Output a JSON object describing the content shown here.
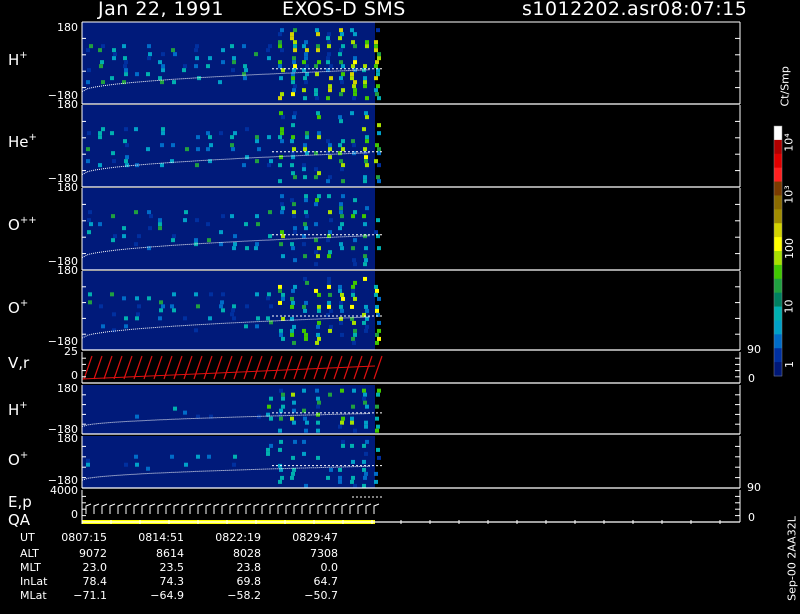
{
  "header": {
    "date": "Jan 22, 1991",
    "mission": "EXOS-D SMS",
    "file": "s1012202.asr",
    "time": "08:07:15"
  },
  "panels": [
    {
      "id": "h1",
      "label": "H",
      "sup": "+",
      "tick_top": "180",
      "tick_bot": "−180"
    },
    {
      "id": "he",
      "label": "He",
      "sup": "+",
      "tick_top": "180",
      "tick_bot": "−180"
    },
    {
      "id": "opp",
      "label": "O",
      "sup": "++",
      "tick_top": "180",
      "tick_bot": "−180"
    },
    {
      "id": "o1",
      "label": "O",
      "sup": "+",
      "tick_top": "180",
      "tick_bot": "−180"
    },
    {
      "id": "vr",
      "label": "V,r",
      "sup": "",
      "tick_top": "25",
      "tick_mid": "0",
      "tick_right_top": "90",
      "tick_right_bot": "0"
    },
    {
      "id": "h2",
      "label": "H",
      "sup": "+",
      "tick_top": "180",
      "tick_bot": "−180"
    },
    {
      "id": "o2",
      "label": "O",
      "sup": "+",
      "tick_top": "180",
      "tick_bot": "−180"
    },
    {
      "id": "ep",
      "label": "E,p",
      "label2": "QA",
      "sup": "",
      "tick_top": "4000",
      "tick_mid": "0",
      "tick_right_top": "90",
      "tick_right_bot": "0"
    }
  ],
  "legend": {
    "title": "Ct/Smp",
    "ticks": [
      {
        "label": "10⁴"
      },
      {
        "label": "10³"
      },
      {
        "label": "100"
      },
      {
        "label": "10"
      },
      {
        "label": "1"
      }
    ],
    "colors": [
      "#ffffff",
      "#b00000",
      "#e00000",
      "#ff2020",
      "#7a3b00",
      "#8a6a00",
      "#a08c00",
      "#d2d200",
      "#ffff00",
      "#a8e000",
      "#40c800",
      "#20a040",
      "#008060",
      "#00b0b0",
      "#00a0c8",
      "#006cc8",
      "#0030a0",
      "#001878"
    ]
  },
  "chart_data": {
    "type": "heatmap",
    "title": "EXOS-D SMS",
    "panels": [
      "H+",
      "He+",
      "O++",
      "O+",
      "V,r",
      "H+",
      "O+",
      "E,p / QA"
    ],
    "y_range_pitch": [
      -180,
      180
    ],
    "colorbar_units": "Ct/Smp",
    "colorbar_range": [
      1,
      10000
    ],
    "colorbar_scale": "log",
    "x_axis": "UT",
    "x_ticks": [
      "0807:15",
      "0814:51",
      "0822:19",
      "0829:47"
    ]
  },
  "footer": {
    "rows": [
      {
        "name": "UT",
        "values": [
          "0807:15",
          "0814:51",
          "0822:19",
          "0829:47"
        ]
      },
      {
        "name": "ALT",
        "values": [
          "9072",
          "8614",
          "8028",
          "7308"
        ]
      },
      {
        "name": "MLT",
        "values": [
          "23.0",
          "23.5",
          "23.8",
          "0.0"
        ]
      },
      {
        "name": "InLat",
        "values": [
          "78.4",
          "74.3",
          "69.8",
          "64.7"
        ]
      },
      {
        "name": "MLat",
        "values": [
          "−71.1",
          "−64.9",
          "−58.2",
          "−50.7"
        ]
      }
    ],
    "side_id": "Sep-00  2AA32L"
  },
  "colors": {
    "bg": "#000000",
    "panel_bg": "#001a7a",
    "axis": "#ffffff",
    "trace": "#ffffff",
    "vr_trace": "#e01010",
    "qa_bar": "#ffff00"
  }
}
